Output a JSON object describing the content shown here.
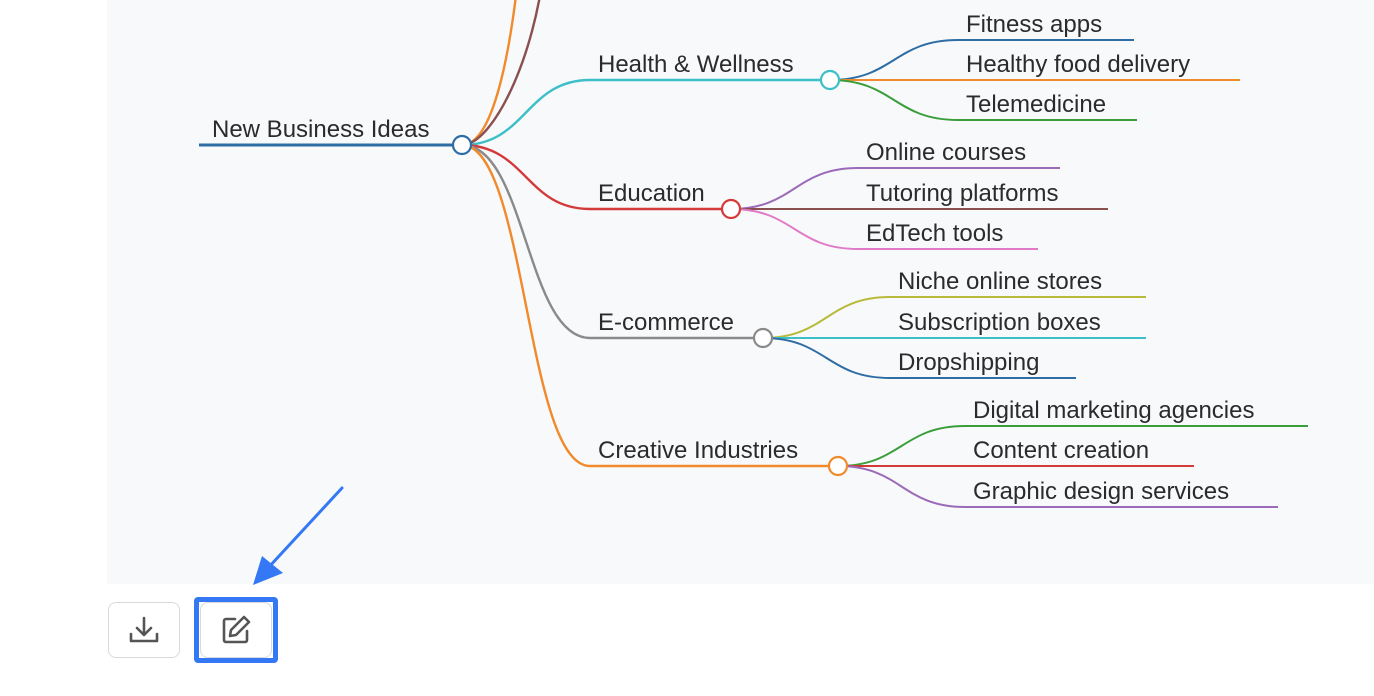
{
  "mindmap": {
    "root": {
      "label": "New Business Ideas",
      "color": "#2e6da4",
      "children": [
        {
          "label": "Health & Wellness",
          "color": "#3cbfc7",
          "children": [
            {
              "label": "Fitness apps",
              "color": "#2e6da4"
            },
            {
              "label": "Healthy food delivery",
              "color": "#f08a2c"
            },
            {
              "label": "Telemedicine",
              "color": "#3a9e3a"
            }
          ]
        },
        {
          "label": "Education",
          "color": "#d33a3a",
          "children": [
            {
              "label": "Online courses",
              "color": "#9b6ab8"
            },
            {
              "label": "Tutoring platforms",
              "color": "#8a5050"
            },
            {
              "label": "EdTech tools",
              "color": "#e07ac8"
            }
          ]
        },
        {
          "label": "E-commerce",
          "color": "#8a8a8a",
          "children": [
            {
              "label": "Niche online stores",
              "color": "#b8ba3a"
            },
            {
              "label": "Subscription boxes",
              "color": "#3cbfc7"
            },
            {
              "label": "Dropshipping",
              "color": "#2e6da4"
            }
          ]
        },
        {
          "label": "Creative Industries",
          "color": "#f08a2c",
          "children": [
            {
              "label": "Digital marketing agencies",
              "color": "#3a9e3a"
            },
            {
              "label": "Content creation",
              "color": "#d33a3a"
            },
            {
              "label": "Graphic design services",
              "color": "#9b6ab8"
            }
          ]
        }
      ],
      "offscreen_branch_colors": [
        "#f08a2c",
        "#8a5050"
      ]
    }
  },
  "toolbar": {
    "download_icon": "download-icon",
    "edit_icon": "edit-icon",
    "highlight_color": "#3478f6"
  }
}
